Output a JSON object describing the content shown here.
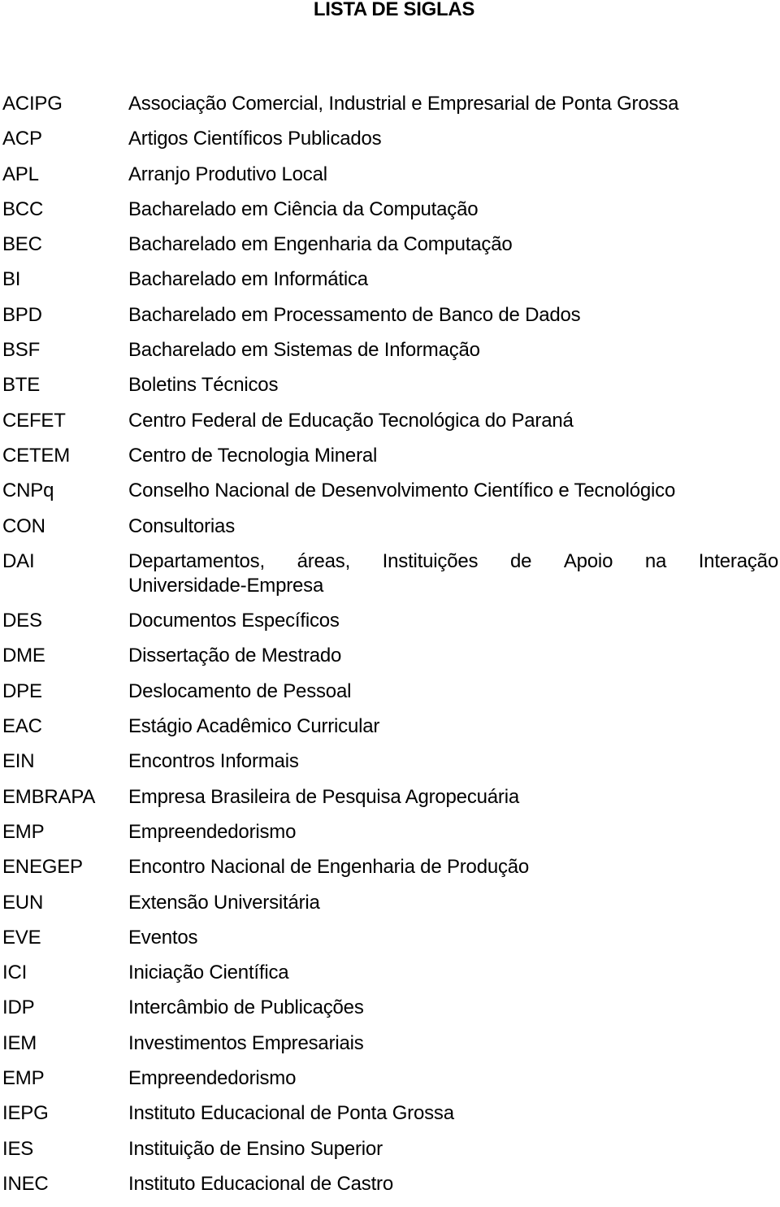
{
  "page": {
    "title": "LISTA DE SIGLAS"
  },
  "siglas": [
    {
      "abbr": "ACIPG",
      "desc": "Associação Comercial, Industrial e Empresarial de Ponta Grossa"
    },
    {
      "abbr": "ACP",
      "desc": "Artigos Científicos Publicados"
    },
    {
      "abbr": "APL",
      "desc": "Arranjo Produtivo Local"
    },
    {
      "abbr": "BCC",
      "desc": "Bacharelado em Ciência da Computação"
    },
    {
      "abbr": "BEC",
      "desc": "Bacharelado em Engenharia da Computação"
    },
    {
      "abbr": "BI",
      "desc": "Bacharelado em Informática"
    },
    {
      "abbr": "BPD",
      "desc": "Bacharelado em Processamento de Banco de Dados"
    },
    {
      "abbr": "BSF",
      "desc": "Bacharelado em Sistemas de Informação"
    },
    {
      "abbr": "BTE",
      "desc": "Boletins Técnicos"
    },
    {
      "abbr": "CEFET",
      "desc": "Centro Federal de Educação Tecnológica do Paraná"
    },
    {
      "abbr": "CETEM",
      "desc": "Centro de Tecnologia Mineral"
    },
    {
      "abbr": "CNPq",
      "desc": "Conselho Nacional de Desenvolvimento Científico e Tecnológico"
    },
    {
      "abbr": "CON",
      "desc": "Consultorias"
    },
    {
      "abbr": "DAI",
      "desc": "Departamentos, áreas, Instituições de Apoio na Interação Universidade-Empresa",
      "desc_line1": [
        "Departamentos,",
        "áreas,",
        "Instituições",
        "de",
        "Apoio",
        "na",
        "Interação"
      ],
      "desc_line2": "Universidade-Empresa"
    },
    {
      "abbr": "DES",
      "desc": "Documentos Específicos"
    },
    {
      "abbr": "DME",
      "desc": "Dissertação de Mestrado"
    },
    {
      "abbr": "DPE",
      "desc": "Deslocamento de Pessoal"
    },
    {
      "abbr": "EAC",
      "desc": "Estágio Acadêmico Curricular"
    },
    {
      "abbr": "EIN",
      "desc": "Encontros Informais"
    },
    {
      "abbr": "EMBRAPA",
      "desc": "Empresa Brasileira de Pesquisa Agropecuária"
    },
    {
      "abbr": "EMP",
      "desc": "Empreendedorismo"
    },
    {
      "abbr": "ENEGEP",
      "desc": "Encontro Nacional de Engenharia de Produção"
    },
    {
      "abbr": "EUN",
      "desc": "Extensão Universitária"
    },
    {
      "abbr": "EVE",
      "desc": "Eventos"
    },
    {
      "abbr": "ICI",
      "desc": "Iniciação Científica"
    },
    {
      "abbr": "IDP",
      "desc": "Intercâmbio de Publicações"
    },
    {
      "abbr": "IEM",
      "desc": "Investimentos Empresariais"
    },
    {
      "abbr": "EMP",
      "desc": "Empreendedorismo"
    },
    {
      "abbr": "IEPG",
      "desc": "Instituto Educacional de Ponta Grossa"
    },
    {
      "abbr": "IES",
      "desc": "Instituição de Ensino Superior"
    },
    {
      "abbr": "INEC",
      "desc": "Instituto Educacional de Castro"
    }
  ]
}
